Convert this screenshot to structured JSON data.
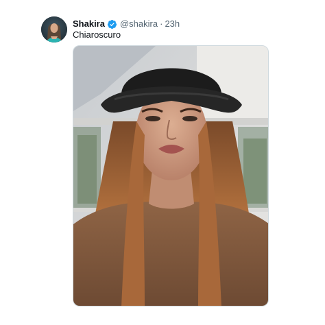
{
  "tweet": {
    "display_name": "Shakira",
    "handle": "@shakira",
    "separator": "·",
    "time": "23h",
    "text": "Chiaroscuro",
    "verified": true,
    "verified_color": "#1d9bf0",
    "avatar_icon": "user-avatar",
    "media_type": "photo"
  }
}
